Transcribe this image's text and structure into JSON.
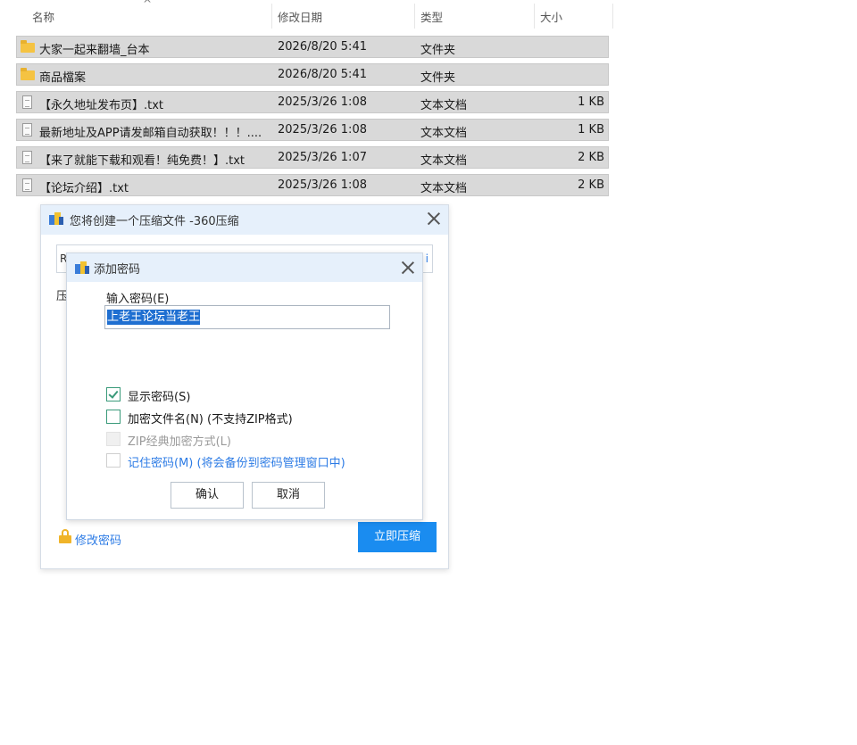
{
  "explorer": {
    "columns": {
      "name": "名称",
      "date": "修改日期",
      "type": "类型",
      "size": "大小"
    },
    "sort_indicator": "^",
    "files": [
      {
        "icon": "folder-icon",
        "name": "大家一起来翻墙_台本",
        "date": "2026/8/20 5:41",
        "type": "文件夹",
        "size": ""
      },
      {
        "icon": "folder-icon",
        "name": "商品檔案",
        "date": "2026/8/20 5:41",
        "type": "文件夹",
        "size": ""
      },
      {
        "icon": "text-file-icon",
        "name": "【永久地址发布页】.txt",
        "date": "2025/3/26 1:08",
        "type": "文本文档",
        "size": "1 KB"
      },
      {
        "icon": "text-file-icon",
        "name": "最新地址及APP请发邮箱自动获取！！！....",
        "date": "2025/3/26 1:08",
        "type": "文本文档",
        "size": "1 KB"
      },
      {
        "icon": "text-file-icon",
        "name": "【来了就能下载和观看！纯免费！】.txt",
        "date": "2025/3/26 1:07",
        "type": "文本文档",
        "size": "2 KB"
      },
      {
        "icon": "text-file-icon",
        "name": "【论坛介绍】.txt",
        "date": "2025/3/26 1:08",
        "type": "文本文档",
        "size": "2 KB"
      }
    ]
  },
  "compress_dialog": {
    "title": "您将创建一个压缩文件 -360压缩",
    "path_edge_left": "R",
    "path_edge_right": "i",
    "side_label": "压",
    "change_password_link": "修改密码",
    "compress_now_button": "立即压缩"
  },
  "password_dialog": {
    "title": "添加密码",
    "password_label": "输入密码(E)",
    "password_value": "上老王论坛当老王",
    "options": [
      {
        "label": "显示密码(S)",
        "checked": true,
        "state": "normal"
      },
      {
        "label": "加密文件名(N) (不支持ZIP格式)",
        "checked": false,
        "state": "normal"
      },
      {
        "label": "ZIP经典加密方式(L)",
        "checked": false,
        "state": "disabled"
      },
      {
        "label": "记住密码(M) (将会备份到密码管理窗口中)",
        "checked": false,
        "state": "blue"
      }
    ],
    "ok_button": "确认",
    "cancel_button": "取消"
  },
  "colors": {
    "row_selected_bg": "#d9d9d9",
    "dialog_titlebar": "#e6f0fb",
    "accent_blue": "#1a8cf0",
    "checkbox_green": "#3a9a7a"
  }
}
